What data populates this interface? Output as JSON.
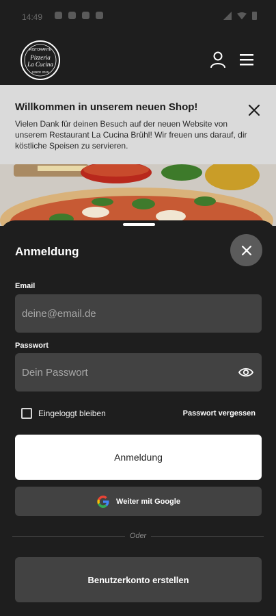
{
  "status_bar": {
    "time": "14:49"
  },
  "header": {
    "logo_text_top": "RISTORANTE",
    "logo_script_1": "Pizzeria",
    "logo_script_2": "La Cucina",
    "logo_text_bottom": "SINCE 2015",
    "account_icon": "user-icon",
    "menu_icon": "hamburger-menu-icon"
  },
  "banner": {
    "title": "Willkommen in unserem neuen Shop!",
    "text": "Vielen Dank für deinen Besuch auf der neuen Website von unserem Restaurant La Cucina Brühl! Wir freuen uns darauf, dir köstliche Speisen zu servieren.",
    "close_icon": "close-icon"
  },
  "login": {
    "title": "Anmeldung",
    "email_label": "Email",
    "email_placeholder": "deine@email.de",
    "email_value": "",
    "password_label": "Passwort",
    "password_placeholder": "Dein Passwort",
    "password_value": "",
    "remember_label": "Eingeloggt bleiben",
    "remember_checked": false,
    "forgot_label": "Passwort vergessen",
    "submit_label": "Anmeldung",
    "google_label": "Weiter mit Google",
    "divider_label": "Oder",
    "register_label": "Benutzerkonto erstellen"
  },
  "colors": {
    "background": "#1e1e1e",
    "input": "#424242",
    "banner": "#dadada",
    "primary_button": "#ffffff"
  }
}
